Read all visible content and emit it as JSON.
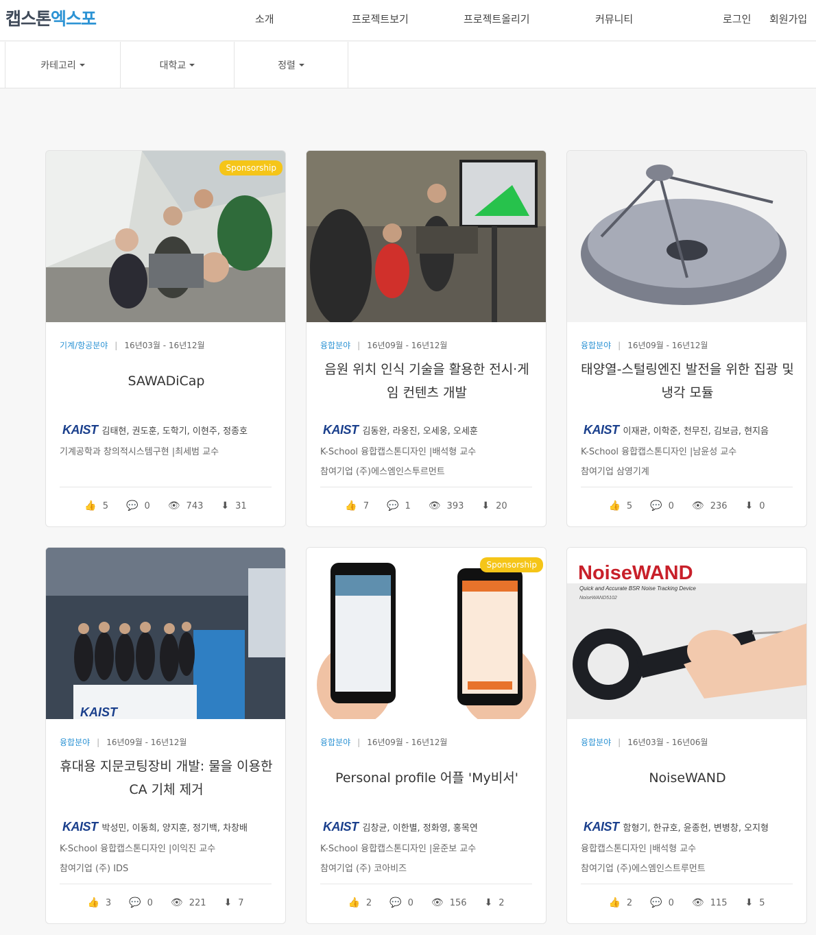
{
  "header": {
    "logo_part1": "캡스톤",
    "logo_part2": "엑스포",
    "nav": [
      "소개",
      "프로젝트보기",
      "프로젝트올리기",
      "커뮤니티"
    ],
    "login": "로그인",
    "signup": "회원가입"
  },
  "filters": [
    "카테고리",
    "대학교",
    "정렬"
  ],
  "cards": [
    {
      "badge": "Sponsorship",
      "category": "기계/항공분야",
      "period": "16년03월 - 16년12월",
      "title": "SAWADiCap",
      "university": "KAIST",
      "members": "김태현, 권도훈, 도학기, 이현주, 정종호",
      "line2": "기계공학과  창의적시스템구현 |최세범 교수",
      "line3": "",
      "likes": "5",
      "comments": "0",
      "views": "743",
      "downloads": "31"
    },
    {
      "badge": "",
      "category": "융합분야",
      "period": "16년09월 - 16년12월",
      "title": "음원 위치 인식 기술을 활용한 전시·게임 컨텐츠 개발",
      "university": "KAIST",
      "members": "김동완, 라웅진, 오세웅, 오세훈",
      "line2": "K-School  융합캡스톤디자인 |배석형 교수",
      "line3": "참여기업 (주)에스엠인스투르먼트",
      "likes": "7",
      "comments": "1",
      "views": "393",
      "downloads": "20"
    },
    {
      "badge": "",
      "category": "융합분야",
      "period": "16년09월 - 16년12월",
      "title": "태양열-스털링엔진 발전을 위한 집광 및 냉각 모듈",
      "university": "KAIST",
      "members": "이재관, 이학준, 천무진, 김보금, 현지음",
      "line2": "K-School  융합캡스톤디자인 |남윤성 교수",
      "line3": "참여기업 삼영기계",
      "likes": "5",
      "comments": "0",
      "views": "236",
      "downloads": "0"
    },
    {
      "badge": "",
      "category": "융합분야",
      "period": "16년09월 - 16년12월",
      "title": "휴대용 지문코팅장비 개발: 물을 이용한 CA 기체 제거",
      "university": "KAIST",
      "members": "박성민, 이동희, 양지훈, 정기백, 차창배",
      "line2": "K-School  융합캡스톤디자인 |이익진 교수",
      "line3": "참여기업 (주) IDS",
      "likes": "3",
      "comments": "0",
      "views": "221",
      "downloads": "7"
    },
    {
      "badge": "Sponsorship",
      "category": "융합분야",
      "period": "16년09월 - 16년12월",
      "title": "Personal profile 어플 'My비서'",
      "university": "KAIST",
      "members": "김창균, 이한별, 정화영, 홍목연",
      "line2": "K-School  융합캡스톤디자인 |윤준보 교수",
      "line3": "참여기업 (주) 코아비즈",
      "likes": "2",
      "comments": "0",
      "views": "156",
      "downloads": "2"
    },
    {
      "badge": "",
      "category": "융합분야",
      "period": "16년03월 - 16년06월",
      "title": "NoiseWAND",
      "university": "KAIST",
      "members": "함형기, 한규호, 윤종헌, 변병창, 오지형",
      "line2": "융합캡스톤디자인 |배석형 교수",
      "line3": "참여기업 (주)에스엠인스트루먼트",
      "likes": "2",
      "comments": "0",
      "views": "115",
      "downloads": "5"
    }
  ],
  "thumb_texts": {
    "noisewand_logo": "NoiseWAND",
    "noisewand_tagline": "Quick and Accurate BSR Noise Tracking Device",
    "noisewand_model": "NoiseWAND5102",
    "kaist_sign": "KAIST"
  }
}
